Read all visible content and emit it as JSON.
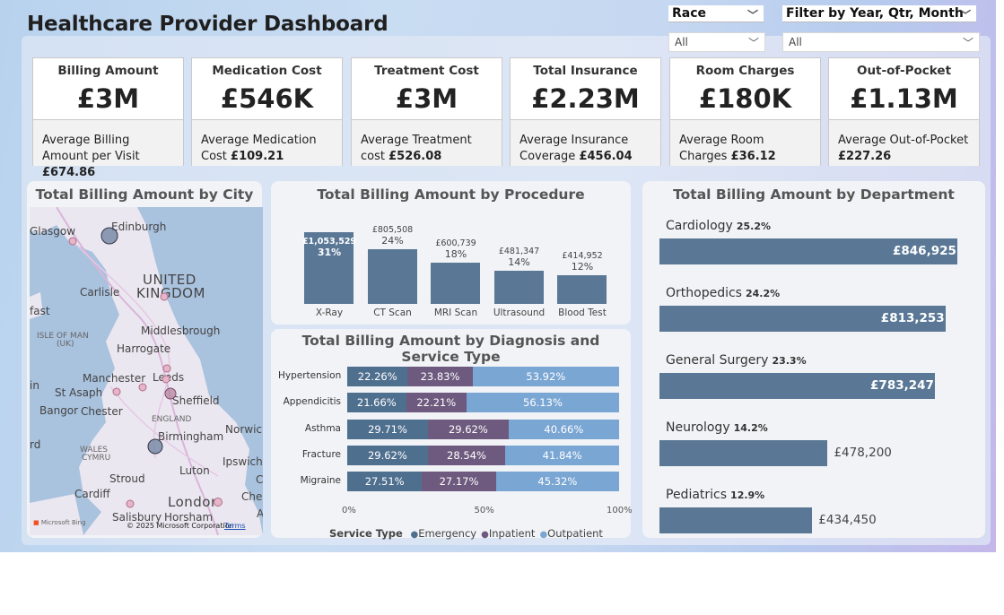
{
  "title": "Healthcare Provider Dashboard",
  "slicers": {
    "race": {
      "label": "Race",
      "value": "All"
    },
    "period": {
      "label": "Filter by Year, Qtr, Month",
      "value": "All"
    }
  },
  "kpis": [
    {
      "label": "Billing Amount",
      "value": "£3M",
      "sub": "Average Billing Amount per Visit",
      "sub_value": "£674.86"
    },
    {
      "label": "Medication Cost",
      "value": "£546K",
      "sub": "Average Medication Cost",
      "sub_value": "£109.21"
    },
    {
      "label": "Treatment Cost",
      "value": "£3M",
      "sub": "Average Treatment cost",
      "sub_value": "£526.08"
    },
    {
      "label": "Total Insurance",
      "value": "£2.23M",
      "sub": "Average Insurance Coverage",
      "sub_value": "£456.04"
    },
    {
      "label": "Room Charges",
      "value": "£180K",
      "sub": "Average Room Charges",
      "sub_value": "£36.12"
    },
    {
      "label": "Out-of-Pocket",
      "value": "£1.13M",
      "sub": "Average Out-of-Pocket",
      "sub_value": "£227.26"
    }
  ],
  "city_map": {
    "title": "Total Billing Amount by City",
    "labels": {
      "glasgow": "Glasgow",
      "edinburgh": "Edinburgh",
      "uk1": "UNITED",
      "uk2": "KINGDOM",
      "carlisle": "Carlisle",
      "fast": "fast",
      "isle1": "ISLE OF MAN",
      "isle2": "(UK)",
      "middlesbrough": "Middlesbrough",
      "harrogate": "Harrogate",
      "manchester": "Manchester",
      "leeds": "Leeds",
      "in": "in",
      "stasaph": "St Asaph",
      "sheffield": "Sheffield",
      "bangor": "Bangor",
      "chester": "Chester",
      "england": "ENGLAND",
      "birmingham": "Birmingham",
      "norwich": "Norwicl",
      "rd": "rd",
      "wales1": "WALES",
      "wales2": "CYMRU",
      "ipswich": "Ipswich",
      "stroud": "Stroud",
      "luton": "Luton",
      "c": "C",
      "cardiff": "Cardiff",
      "london": "London",
      "che": "Che",
      "salisbury": "Salisbury",
      "horsham": "Horsham",
      "a": "A"
    },
    "attribution": "Microsoft Bing",
    "copyright": "© 2025 Microsoft Corporation",
    "terms": "Terms"
  },
  "procedure": {
    "title": "Total Billing Amount by Procedure",
    "colors": {
      "bar": "#5a7896"
    }
  },
  "diagnosis": {
    "title": "Total Billing Amount by Diagnosis and Service Type",
    "legend_title": "Service Type",
    "colors": {
      "Emergency": "#4f6f8f",
      "Inpatient": "#6e5a7e",
      "Outpatient": "#7aa6d4"
    }
  },
  "department": {
    "title": "Total Billing Amount by Department"
  },
  "chart_data": [
    {
      "type": "bar",
      "title": "Total Billing Amount by Procedure",
      "categories": [
        "X-Ray",
        "CT Scan",
        "MRI Scan",
        "Ultrasound",
        "Blood Test"
      ],
      "values": [
        1053529,
        805508,
        600739,
        481347,
        414952
      ],
      "value_labels": [
        "£1,053,529",
        "£805,508",
        "£600,739",
        "£481,347",
        "£414,952"
      ],
      "percent_labels": [
        "31%",
        "24%",
        "18%",
        "14%",
        "12%"
      ]
    },
    {
      "type": "bar",
      "title": "Total Billing Amount by Diagnosis and Service Type",
      "orientation": "horizontal",
      "stacked": "100%",
      "categories": [
        "Hypertension",
        "Appendicitis",
        "Asthma",
        "Fracture",
        "Migraine"
      ],
      "series": [
        {
          "name": "Emergency",
          "values": [
            22.26,
            21.66,
            29.71,
            29.62,
            27.51
          ],
          "labels": [
            "22.26%",
            "21.66%",
            "29.71%",
            "29.62%",
            "27.51%"
          ]
        },
        {
          "name": "Inpatient",
          "values": [
            23.83,
            22.21,
            29.62,
            28.54,
            27.17
          ],
          "labels": [
            "23.83%",
            "22.21%",
            "29.62%",
            "28.54%",
            "27.17%"
          ]
        },
        {
          "name": "Outpatient",
          "values": [
            53.92,
            56.13,
            40.66,
            41.84,
            45.32
          ],
          "labels": [
            "53.92%",
            "56.13%",
            "40.66%",
            "41.84%",
            "45.32%"
          ]
        }
      ],
      "x_ticks": [
        "0%",
        "50%",
        "100%"
      ],
      "xlim": [
        0,
        100
      ],
      "legend_position": "bottom"
    },
    {
      "type": "bar",
      "title": "Total Billing Amount by Department",
      "orientation": "horizontal",
      "categories": [
        "Cardiology",
        "Orthopedics",
        "General Surgery",
        "Neurology",
        "Pediatrics"
      ],
      "values": [
        846925,
        813253,
        783247,
        478200,
        434450
      ],
      "value_labels": [
        "£846,925",
        "£813,253",
        "£783,247",
        "£478,200",
        "£434,450"
      ],
      "percent_labels": [
        "25.2%",
        "24.2%",
        "23.3%",
        "14.2%",
        "12.9%"
      ]
    }
  ]
}
